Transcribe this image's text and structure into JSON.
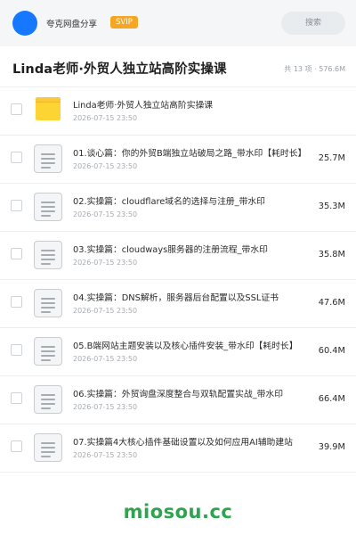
{
  "header": {
    "brand": "夸克网盘分享",
    "badge": "SVIP",
    "search_placeholder": "搜索"
  },
  "share": {
    "title": "Linda老师·外贸人独立站高阶实操课",
    "summary": "共 13 项 · 576.6M"
  },
  "files": [
    {
      "type": "folder",
      "icon": "folder-icon",
      "name": "Linda老师·外贸人独立站高阶实操课",
      "date": "2026-07-15 23:50",
      "size": ""
    },
    {
      "type": "file",
      "icon": "document-icon",
      "name": "01.谈心篇：你的外贸B端独立站破局之路_带水印【耗时长】",
      "date": "2026-07-15 23:50",
      "size": "25.7M"
    },
    {
      "type": "file",
      "icon": "document-icon",
      "name": "02.实操篇：cloudflare域名的选择与注册_带水印",
      "date": "2026-07-15 23:50",
      "size": "35.3M"
    },
    {
      "type": "file",
      "icon": "document-icon",
      "name": "03.实操篇：cloudways服务器的注册流程_带水印",
      "date": "2026-07-15 23:50",
      "size": "35.8M"
    },
    {
      "type": "file",
      "icon": "document-icon",
      "name": "04.实操篇：DNS解析，服务器后台配置以及SSL证书",
      "date": "2026-07-15 23:50",
      "size": "47.6M"
    },
    {
      "type": "file",
      "icon": "document-icon",
      "name": "05.B端网站主题安装以及核心插件安装_带水印【耗时长】",
      "date": "2026-07-15 23:50",
      "size": "60.4M"
    },
    {
      "type": "file",
      "icon": "document-icon",
      "name": "06.实操篇：外贸询盘深度整合与双轨配置实战_带水印",
      "date": "2026-07-15 23:50",
      "size": "66.4M"
    },
    {
      "type": "file",
      "icon": "document-icon",
      "name": "07.实操篇4大核心插件基础设置以及如何应用AI辅助建站",
      "date": "2026-07-15 23:50",
      "size": "39.9M"
    }
  ],
  "watermark": "miosou.cc",
  "colors": {
    "accent": "#1677ff",
    "badge": "#f5a623",
    "folder": "#fcd534",
    "watermark": "#2ea44f"
  }
}
